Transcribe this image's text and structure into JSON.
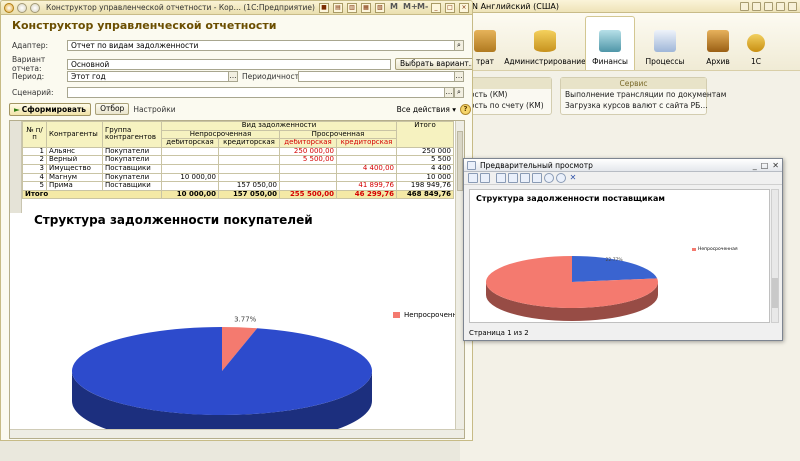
{
  "background_window": {
    "title": "EN Английский (США)",
    "sections": [
      {
        "label": "трат"
      },
      {
        "label": "Администрирование"
      },
      {
        "label": "Финансы"
      },
      {
        "label": "Процессы"
      },
      {
        "label": "Архив"
      },
      {
        "label": "1С"
      }
    ],
    "panel_left": {
      "rows": [
        "ность (КМ)",
        "ность по счету (КМ)"
      ]
    },
    "panel_service": {
      "header": "Сервис",
      "rows": [
        "Выполнение трансляции по документам",
        "Загрузка курсов валют с сайта РБ…"
      ]
    }
  },
  "main_window": {
    "title": "Конструктор управленческой отчетности - Кор… (1С:Предприятие)",
    "form_title": "Конструктор управленческой отчетности",
    "fields": {
      "adapter_label": "Адаптер:",
      "adapter_value": "Отчет по видам задолженности",
      "variant_label": "Вариант отчета:",
      "variant_value": "Основной",
      "choose_variant": "Выбрать вариант...",
      "period_label": "Период:",
      "period_value": "Этот год",
      "periodicity_label": "Периодичность:",
      "periodicity_value": "",
      "scenario_label": "Сценарий:",
      "scenario_value": ""
    },
    "toolbar": {
      "generate": "Сформировать",
      "filter": "Отбор",
      "settings": "Настройки",
      "all_actions": "Все действия ▾",
      "help": "?"
    },
    "report": {
      "headers": {
        "num": "№ п/п",
        "contractors": "Контрагенты",
        "group": "Группа контрагентов",
        "debt_type": "Вид задолженности",
        "total": "Итого",
        "non_overdue": "Непросроченная",
        "overdue": "Просроченная",
        "debit": "дебиторская",
        "credit": "кредиторская"
      },
      "rows": [
        {
          "n": "1",
          "name": "Альянс",
          "group": "Покупатели",
          "nd": "",
          "nc": "",
          "od": "250 000,00",
          "oc": "",
          "total": "250 000"
        },
        {
          "n": "2",
          "name": "Верный",
          "group": "Покупатели",
          "nd": "",
          "nc": "",
          "od": "5 500,00",
          "oc": "",
          "total": "5 500"
        },
        {
          "n": "3",
          "name": "Имущество",
          "group": "Поставщики",
          "nd": "",
          "nc": "",
          "od": "",
          "oc": "4 400,00",
          "total": "4 400"
        },
        {
          "n": "4",
          "name": "Магнум",
          "group": "Покупатели",
          "nd": "10 000,00",
          "nc": "",
          "od": "",
          "oc": "",
          "total": "10 000"
        },
        {
          "n": "5",
          "name": "Прима",
          "group": "Поставщики",
          "nd": "",
          "nc": "157 050,00",
          "od": "",
          "oc": "41 899,76",
          "total": "198 949,76"
        }
      ],
      "totals": {
        "label": "Итого",
        "nd": "10 000,00",
        "nc": "157 050,00",
        "od": "255 500,00",
        "oc": "46 299,76",
        "total": "468 849,76"
      }
    },
    "chart": {
      "title": "Структура задолженности покупателей",
      "legend": "Непросроченная",
      "slice_label": "3.77%"
    }
  },
  "preview_window": {
    "title": "Предварительный просмотр",
    "chart_title": "Структура задолженности поставщикам",
    "legend": "Непросроченная",
    "slice_label": "22.77%",
    "status": "Страница 1 из 2"
  },
  "chart_data": [
    {
      "type": "pie",
      "title": "Структура задолженности покупателей",
      "slices": [
        {
          "name": "Непросроченная",
          "value": 3.77,
          "color": "#f47a6f"
        },
        {
          "name": "",
          "value": 96.23,
          "color": "#2d4bcc"
        }
      ],
      "legend": [
        "Непросроченная"
      ],
      "legend_position": "right"
    },
    {
      "type": "pie",
      "title": "Структура задолженности поставщикам",
      "slices": [
        {
          "name": "",
          "value": 22.77,
          "color": "#3a64d0"
        },
        {
          "name": "Непросроченная",
          "value": 77.23,
          "color": "#f47a6f"
        }
      ],
      "legend": [
        "Непросроченная"
      ],
      "legend_position": "right"
    }
  ]
}
